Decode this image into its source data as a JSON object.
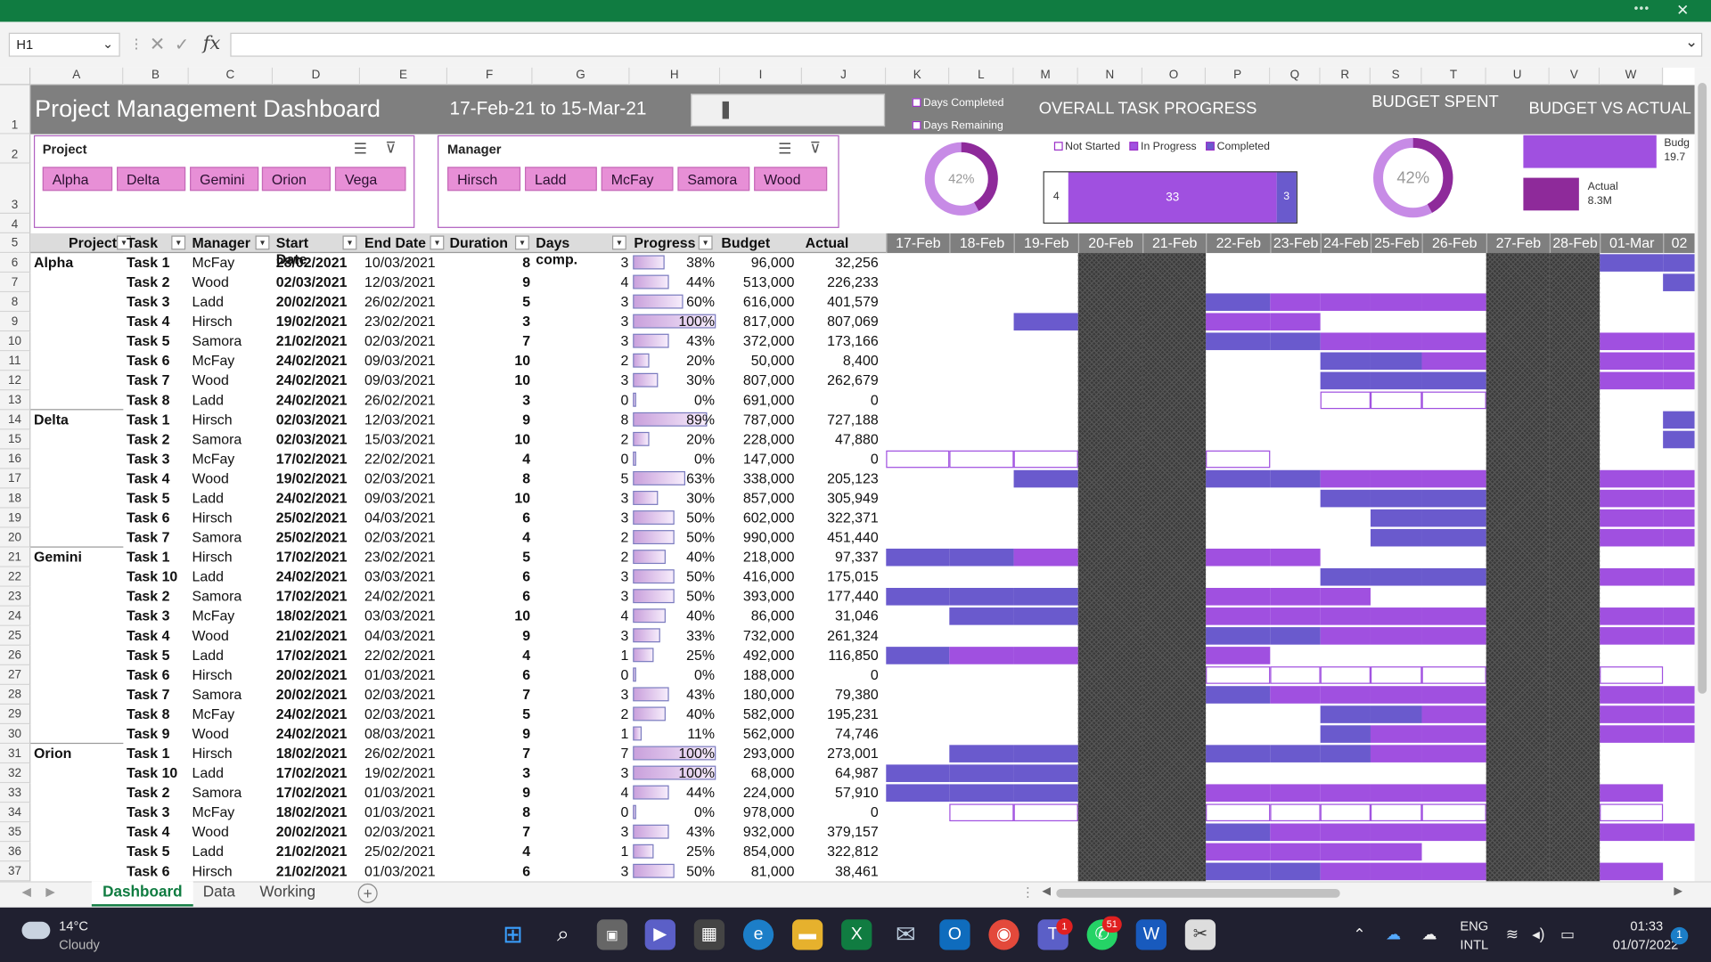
{
  "formula_bar": {
    "name_box": "H1",
    "fx": "fx",
    "formula": ""
  },
  "title": "Project Management Dashboard",
  "date_range": "17-Feb-21 to 15-Mar-21",
  "columns": [
    "A",
    "B",
    "C",
    "D",
    "E",
    "F",
    "G",
    "H",
    "I",
    "J",
    "K",
    "L",
    "M",
    "N",
    "O",
    "P",
    "Q",
    "R",
    "S",
    "T",
    "U",
    "V",
    "W"
  ],
  "row_numbers": [
    "1",
    "2",
    "3",
    "4",
    "5",
    "6",
    "7",
    "8",
    "9",
    "10",
    "11",
    "12",
    "13",
    "14",
    "15",
    "16",
    "17",
    "18",
    "19",
    "20",
    "21",
    "22",
    "23",
    "24",
    "25",
    "26",
    "27",
    "28",
    "29",
    "30",
    "31",
    "32",
    "33",
    "34",
    "35",
    "36",
    "37"
  ],
  "donut_legend": {
    "completed": "Days Completed",
    "remaining": "Days Remaining"
  },
  "overall_progress": {
    "title": "OVERALL TASK PROGRESS",
    "legend": [
      "Not Started",
      "In Progress",
      "Completed"
    ],
    "not_started": "4",
    "in_progress": "33",
    "completed": "3"
  },
  "donut1": {
    "label": "42%",
    "value": 0.42
  },
  "budget_spent": {
    "title": "BUDGET SPENT",
    "label": "42%",
    "value": 0.42
  },
  "budget_vs_actual": {
    "title": "BUDGET VS ACTUAL",
    "budget_label": "Budg",
    "budget_value": "19.7",
    "actual_label": "Actual",
    "actual_value": "8.3M"
  },
  "slicers": {
    "project": {
      "title": "Project",
      "items": [
        "Alpha",
        "Delta",
        "Gemini",
        "Orion",
        "Vega"
      ]
    },
    "manager": {
      "title": "Manager",
      "items": [
        "Hirsch",
        "Ladd",
        "McFay",
        "Samora",
        "Wood"
      ]
    }
  },
  "table_headers": [
    "Project",
    "Task",
    "Manager",
    "Start Date",
    "End Date",
    "Duration",
    "Days comp.",
    "Progress",
    "Budget",
    "Actual"
  ],
  "gantt_dates": [
    "17-Feb",
    "18-Feb",
    "19-Feb",
    "20-Feb",
    "21-Feb",
    "22-Feb",
    "23-Feb",
    "24-Feb",
    "25-Feb",
    "26-Feb",
    "27-Feb",
    "28-Feb",
    "01-Mar",
    "02"
  ],
  "colors": {
    "completed": "#6a5acd",
    "in_progress": "#a050e0",
    "header": "#7f7f7f",
    "weekend": "#3a3a3a",
    "slicer_btn": "#e78fd6",
    "donut": "#8e2a9a"
  },
  "rows": [
    {
      "project": "Alpha",
      "task": "Task 1",
      "manager": "McFay",
      "start": "28/02/2021",
      "end": "10/03/2021",
      "duration": "8",
      "days": "3",
      "progress": "38%",
      "pval": 0.38,
      "budget": "96,000",
      "actual": "32,256"
    },
    {
      "project": "",
      "task": "Task 2",
      "manager": "Wood",
      "start": "02/03/2021",
      "end": "12/03/2021",
      "duration": "9",
      "days": "4",
      "progress": "44%",
      "pval": 0.44,
      "budget": "513,000",
      "actual": "226,233"
    },
    {
      "project": "",
      "task": "Task 3",
      "manager": "Ladd",
      "start": "20/02/2021",
      "end": "26/02/2021",
      "duration": "5",
      "days": "3",
      "progress": "60%",
      "pval": 0.6,
      "budget": "616,000",
      "actual": "401,579"
    },
    {
      "project": "",
      "task": "Task 4",
      "manager": "Hirsch",
      "start": "19/02/2021",
      "end": "23/02/2021",
      "duration": "3",
      "days": "3",
      "progress": "100%",
      "pval": 1.0,
      "budget": "817,000",
      "actual": "807,069"
    },
    {
      "project": "",
      "task": "Task 5",
      "manager": "Samora",
      "start": "21/02/2021",
      "end": "02/03/2021",
      "duration": "7",
      "days": "3",
      "progress": "43%",
      "pval": 0.43,
      "budget": "372,000",
      "actual": "173,166"
    },
    {
      "project": "",
      "task": "Task 6",
      "manager": "McFay",
      "start": "24/02/2021",
      "end": "09/03/2021",
      "duration": "10",
      "days": "2",
      "progress": "20%",
      "pval": 0.2,
      "budget": "50,000",
      "actual": "8,400"
    },
    {
      "project": "",
      "task": "Task 7",
      "manager": "Wood",
      "start": "24/02/2021",
      "end": "09/03/2021",
      "duration": "10",
      "days": "3",
      "progress": "30%",
      "pval": 0.3,
      "budget": "807,000",
      "actual": "262,679"
    },
    {
      "project": "",
      "task": "Task 8",
      "manager": "Ladd",
      "start": "24/02/2021",
      "end": "26/02/2021",
      "duration": "3",
      "days": "0",
      "progress": "0%",
      "pval": 0,
      "budget": "691,000",
      "actual": "0"
    },
    {
      "project": "Delta",
      "task": "Task 1",
      "manager": "Hirsch",
      "start": "02/03/2021",
      "end": "12/03/2021",
      "duration": "9",
      "days": "8",
      "progress": "89%",
      "pval": 0.89,
      "budget": "787,000",
      "actual": "727,188"
    },
    {
      "project": "",
      "task": "Task 2",
      "manager": "Samora",
      "start": "02/03/2021",
      "end": "15/03/2021",
      "duration": "10",
      "days": "2",
      "progress": "20%",
      "pval": 0.2,
      "budget": "228,000",
      "actual": "47,880"
    },
    {
      "project": "",
      "task": "Task 3",
      "manager": "McFay",
      "start": "17/02/2021",
      "end": "22/02/2021",
      "duration": "4",
      "days": "0",
      "progress": "0%",
      "pval": 0,
      "budget": "147,000",
      "actual": "0"
    },
    {
      "project": "",
      "task": "Task 4",
      "manager": "Wood",
      "start": "19/02/2021",
      "end": "02/03/2021",
      "duration": "8",
      "days": "5",
      "progress": "63%",
      "pval": 0.63,
      "budget": "338,000",
      "actual": "205,123"
    },
    {
      "project": "",
      "task": "Task 5",
      "manager": "Ladd",
      "start": "24/02/2021",
      "end": "09/03/2021",
      "duration": "10",
      "days": "3",
      "progress": "30%",
      "pval": 0.3,
      "budget": "857,000",
      "actual": "305,949"
    },
    {
      "project": "",
      "task": "Task 6",
      "manager": "Hirsch",
      "start": "25/02/2021",
      "end": "04/03/2021",
      "duration": "6",
      "days": "3",
      "progress": "50%",
      "pval": 0.5,
      "budget": "602,000",
      "actual": "322,371"
    },
    {
      "project": "",
      "task": "Task 7",
      "manager": "Samora",
      "start": "25/02/2021",
      "end": "02/03/2021",
      "duration": "4",
      "days": "2",
      "progress": "50%",
      "pval": 0.5,
      "budget": "990,000",
      "actual": "451,440"
    },
    {
      "project": "Gemini",
      "task": "Task 1",
      "manager": "Hirsch",
      "start": "17/02/2021",
      "end": "23/02/2021",
      "duration": "5",
      "days": "2",
      "progress": "40%",
      "pval": 0.4,
      "budget": "218,000",
      "actual": "97,337"
    },
    {
      "project": "",
      "task": "Task 10",
      "manager": "Ladd",
      "start": "24/02/2021",
      "end": "03/03/2021",
      "duration": "6",
      "days": "3",
      "progress": "50%",
      "pval": 0.5,
      "budget": "416,000",
      "actual": "175,015"
    },
    {
      "project": "",
      "task": "Task 2",
      "manager": "Samora",
      "start": "17/02/2021",
      "end": "24/02/2021",
      "duration": "6",
      "days": "3",
      "progress": "50%",
      "pval": 0.5,
      "budget": "393,000",
      "actual": "177,440"
    },
    {
      "project": "",
      "task": "Task 3",
      "manager": "McFay",
      "start": "18/02/2021",
      "end": "03/03/2021",
      "duration": "10",
      "days": "4",
      "progress": "40%",
      "pval": 0.4,
      "budget": "86,000",
      "actual": "31,046"
    },
    {
      "project": "",
      "task": "Task 4",
      "manager": "Wood",
      "start": "21/02/2021",
      "end": "04/03/2021",
      "duration": "9",
      "days": "3",
      "progress": "33%",
      "pval": 0.33,
      "budget": "732,000",
      "actual": "261,324"
    },
    {
      "project": "",
      "task": "Task 5",
      "manager": "Ladd",
      "start": "17/02/2021",
      "end": "22/02/2021",
      "duration": "4",
      "days": "1",
      "progress": "25%",
      "pval": 0.25,
      "budget": "492,000",
      "actual": "116,850"
    },
    {
      "project": "",
      "task": "Task 6",
      "manager": "Hirsch",
      "start": "20/02/2021",
      "end": "01/03/2021",
      "duration": "6",
      "days": "0",
      "progress": "0%",
      "pval": 0,
      "budget": "188,000",
      "actual": "0"
    },
    {
      "project": "",
      "task": "Task 7",
      "manager": "Samora",
      "start": "20/02/2021",
      "end": "02/03/2021",
      "duration": "7",
      "days": "3",
      "progress": "43%",
      "pval": 0.43,
      "budget": "180,000",
      "actual": "79,380"
    },
    {
      "project": "",
      "task": "Task 8",
      "manager": "McFay",
      "start": "24/02/2021",
      "end": "02/03/2021",
      "duration": "5",
      "days": "2",
      "progress": "40%",
      "pval": 0.4,
      "budget": "582,000",
      "actual": "195,231"
    },
    {
      "project": "",
      "task": "Task 9",
      "manager": "Wood",
      "start": "24/02/2021",
      "end": "08/03/2021",
      "duration": "9",
      "days": "1",
      "progress": "11%",
      "pval": 0.11,
      "budget": "562,000",
      "actual": "74,746"
    },
    {
      "project": "Orion",
      "task": "Task 1",
      "manager": "Hirsch",
      "start": "18/02/2021",
      "end": "26/02/2021",
      "duration": "7",
      "days": "7",
      "progress": "100%",
      "pval": 1.0,
      "budget": "293,000",
      "actual": "273,001"
    },
    {
      "project": "",
      "task": "Task 10",
      "manager": "Ladd",
      "start": "17/02/2021",
      "end": "19/02/2021",
      "duration": "3",
      "days": "3",
      "progress": "100%",
      "pval": 1.0,
      "budget": "68,000",
      "actual": "64,987"
    },
    {
      "project": "",
      "task": "Task 2",
      "manager": "Samora",
      "start": "17/02/2021",
      "end": "01/03/2021",
      "duration": "9",
      "days": "4",
      "progress": "44%",
      "pval": 0.44,
      "budget": "224,000",
      "actual": "57,910"
    },
    {
      "project": "",
      "task": "Task 3",
      "manager": "McFay",
      "start": "18/02/2021",
      "end": "01/03/2021",
      "duration": "8",
      "days": "0",
      "progress": "0%",
      "pval": 0,
      "budget": "978,000",
      "actual": "0"
    },
    {
      "project": "",
      "task": "Task 4",
      "manager": "Wood",
      "start": "20/02/2021",
      "end": "02/03/2021",
      "duration": "7",
      "days": "3",
      "progress": "43%",
      "pval": 0.43,
      "budget": "932,000",
      "actual": "379,157"
    },
    {
      "project": "",
      "task": "Task 5",
      "manager": "Ladd",
      "start": "21/02/2021",
      "end": "25/02/2021",
      "duration": "4",
      "days": "1",
      "progress": "25%",
      "pval": 0.25,
      "budget": "854,000",
      "actual": "322,812"
    },
    {
      "project": "",
      "task": "Task 6",
      "manager": "Hirsch",
      "start": "21/02/2021",
      "end": "01/03/2021",
      "duration": "6",
      "days": "3",
      "progress": "50%",
      "pval": 0.5,
      "budget": "81,000",
      "actual": "38,461"
    }
  ],
  "sheet_tabs": [
    "Dashboard",
    "Data",
    "Working"
  ],
  "taskbar": {
    "weather_temp": "14°C",
    "weather_text": "Cloudy",
    "lang1": "ENG",
    "lang2": "INTL",
    "time": "01:33",
    "date": "01/07/2022",
    "teams_badge": "1",
    "whatsapp_badge": "51",
    "notif_count": "1"
  }
}
